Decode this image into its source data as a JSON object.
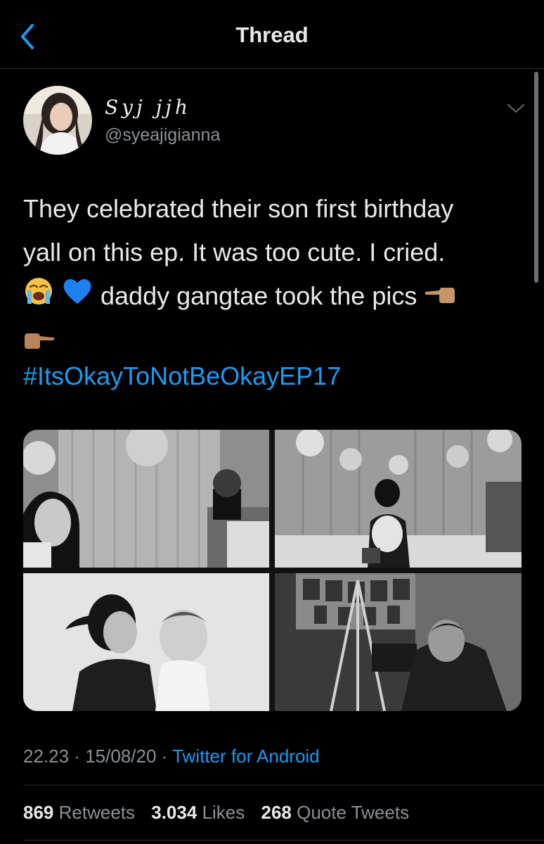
{
  "nav": {
    "title": "Thread"
  },
  "author": {
    "display_name": "Syj jjh",
    "handle": "@syeajigianna"
  },
  "tweet": {
    "line1": "They celebrated their son first birthday",
    "line2": "yall on this ep. It was too cute. I cried.",
    "line3_text": " daddy gangtae took the pics ",
    "hashtag": "#ItsOkayToNotBeOkayEP17"
  },
  "emojis": [
    "loudly-crying-face",
    "blue-heart",
    "backhand-index-pointing-left",
    "backhand-index-pointing-right"
  ],
  "media": [
    "photo-mother-child-party",
    "photo-birthday-table-balloons",
    "photo-mother-holding-baby",
    "photo-man-with-camera"
  ],
  "meta": {
    "time": "22.23",
    "date": "15/08/20",
    "separator": "·",
    "source": "Twitter for Android"
  },
  "stats": {
    "retweets_count": "869",
    "retweets_label": "Retweets",
    "likes_count": "3.034",
    "likes_label": "Likes",
    "quotes_count": "268",
    "quotes_label": "Quote Tweets"
  },
  "colors": {
    "background": "#000000",
    "link": "#1d9bf0",
    "muted": "#8b9197",
    "text": "#e7e9ea"
  }
}
